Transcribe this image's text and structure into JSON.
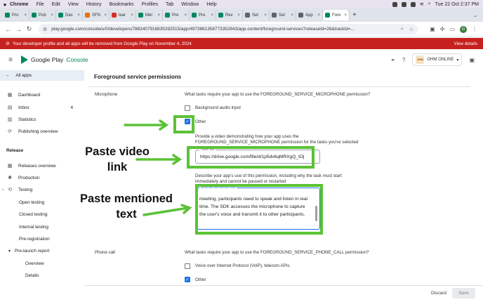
{
  "menubar": {
    "apple_icon": "apple-icon",
    "items": [
      "Chrome",
      "File",
      "Edit",
      "View",
      "History",
      "Bookmarks",
      "Profiles",
      "Tab",
      "Window",
      "Help"
    ],
    "clock": "Tue 22 Oct  2:37 PM"
  },
  "tabs": [
    {
      "label": "Pro",
      "color": "#01875f"
    },
    {
      "label": "Pub",
      "color": "#01875f"
    },
    {
      "label": "Das",
      "color": "#01875f"
    },
    {
      "label": "SFN",
      "color": "#e8710a"
    },
    {
      "label": "lear",
      "color": "#d93025"
    },
    {
      "label": "Mer",
      "color": "#01875f"
    },
    {
      "label": "Pre",
      "color": "#01875f"
    },
    {
      "label": "Pre",
      "color": "#01875f"
    },
    {
      "label": "Rev",
      "color": "#01875f"
    },
    {
      "label": "Set",
      "color": "#5f6368"
    },
    {
      "label": "Set",
      "color": "#5f6368"
    },
    {
      "label": "App",
      "color": "#5f6368"
    },
    {
      "label": "Fore",
      "color": "#01875f",
      "active": true
    }
  ],
  "toolbar": {
    "url": "play.google.com/console/u/0/developers/7883407916835292515/app/4973861358773352843/app-content/foreground-services?releaseId=26&trackId=..."
  },
  "banner": {
    "text": "Your developer profile and all apps will be removed from Google Play on November 4, 2024",
    "link": "View details"
  },
  "header": {
    "logo_part1": "Google Play",
    "logo_part2": "Console",
    "account_label": "OHM ONLINE",
    "account_badge": "OHM"
  },
  "sidebar": {
    "all_apps": "All apps",
    "dashboard": "Dashboard",
    "inbox": "Inbox",
    "inbox_count": "4",
    "statistics": "Statistics",
    "publishing_overview": "Publishing overview",
    "release_header": "Release",
    "releases_overview": "Releases overview",
    "production": "Production",
    "testing": "Testing",
    "open_testing": "Open testing",
    "closed_testing": "Closed testing",
    "internal_testing": "Internal testing",
    "pre_registration": "Pre-registration",
    "pre_launch_report": "Pre-launch report",
    "overview": "Overview",
    "details": "Details"
  },
  "main": {
    "title": "Foreground service permissions",
    "microphone_label": "Microphone",
    "microphone_question": "What tasks require your app to use the FOREGROUND_SERVICE_MICROPHONE permission?",
    "background_audio": "Background audio input",
    "other": "Other",
    "video_help_line1": "Provide a video demonstrating how your app uses the",
    "video_help_line2": "FOREGROUND_SERVICE_MICROPHONE permission for the tasks you've selected",
    "video_field_label": "Video link",
    "video_value": "https://drive.google.com/file/d/1p5dv6qMRXgQ_IOj",
    "desc_help_line1": "Describe your app's use of this permission, including why the task must start",
    "desc_help_line2": "immediately and cannot be paused or restarted",
    "desc_field_label": "Describe permission use",
    "desc_value": "meeting, participants need to speak and listen in real time. The SDK accesses the microphone to capture the user's voice and transmit it to other participants.",
    "phone_call_label": "Phone call",
    "phone_question": "What tasks require your app to use the FOREGROUND_SERVICE_PHONE_CALL permission?",
    "voip": "Voice over Internet Protocol (VoIP), telecom APIs",
    "other2": "Other"
  },
  "footer": {
    "discard": "Discard",
    "save": "Save"
  },
  "annotations": {
    "paste_video_line1": "Paste video",
    "paste_video_line2": "link",
    "paste_text_line1": "Paste mentioned",
    "paste_text_line2": "text",
    "highlight_color": "#5bc236"
  }
}
